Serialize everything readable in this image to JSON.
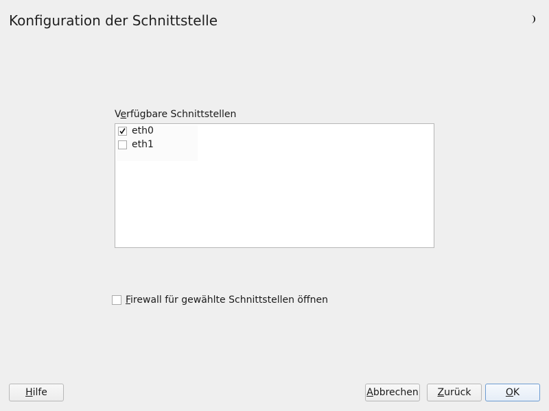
{
  "header": {
    "title": "Konfiguration der Schnittstelle",
    "theme_icon": "moon-icon"
  },
  "interfaces": {
    "label_mnemonic": "e",
    "label_before": "V",
    "label_after": "rfügbare Schnittstellen",
    "items": [
      {
        "label": "eth0",
        "checked": true
      },
      {
        "label": "eth1",
        "checked": false
      }
    ]
  },
  "firewall": {
    "mnemonic": "F",
    "label_rest": "irewall für gewählte Schnittstellen öffnen",
    "checked": false
  },
  "buttons": {
    "help": {
      "mnemonic": "H",
      "rest": "ilfe"
    },
    "cancel": {
      "mnemonic": "A",
      "rest": "bbrechen"
    },
    "back": {
      "mnemonic": "Z",
      "rest": "urück"
    },
    "ok": {
      "mnemonic": "O",
      "rest": "K"
    }
  },
  "colors": {
    "background": "#efefef",
    "list_background": "#ffffff",
    "ok_border": "#6c9bd1"
  }
}
